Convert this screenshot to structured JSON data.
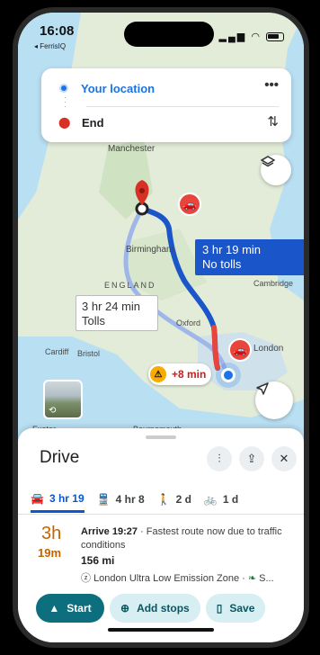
{
  "status_bar": {
    "time": "16:08",
    "back_app": "◂ FerrisIQ"
  },
  "search": {
    "origin": "Your location",
    "destination": "End"
  },
  "map": {
    "places": [
      "Manchester",
      "Birmingham",
      "ENGLAND",
      "Cambridge",
      "Oxford",
      "Cardiff",
      "Bristol",
      "London",
      "Exeter",
      "Bournemouth"
    ],
    "primary_route": {
      "time": "3 hr 19 min",
      "note": "No tolls"
    },
    "alt_route": {
      "time": "3 hr 24 min",
      "note": "Tolls"
    },
    "delay": "+8 min",
    "colors": {
      "route": "#1a56c9",
      "alt_route": "#9fb6e8",
      "traffic": "#e8453c"
    }
  },
  "sheet": {
    "title": "Drive",
    "modes": [
      {
        "icon": "car-icon",
        "label": "3 hr 19"
      },
      {
        "icon": "train-icon",
        "label": "4 hr 8"
      },
      {
        "icon": "walk-icon",
        "label": "2 d"
      },
      {
        "icon": "bike-icon",
        "label": "1 d"
      }
    ],
    "duration_hours": "3h",
    "duration_minutes": "19m",
    "arrive": "Arrive 19:27",
    "arrive_note": " · Fastest route now due to traffic conditions",
    "distance": "156 mi",
    "zone_note": "London Ultra Low Emission Zone · ",
    "zone_more": "S...",
    "buttons": {
      "start": "Start",
      "add_stops": "Add stops",
      "save": "Save"
    }
  }
}
